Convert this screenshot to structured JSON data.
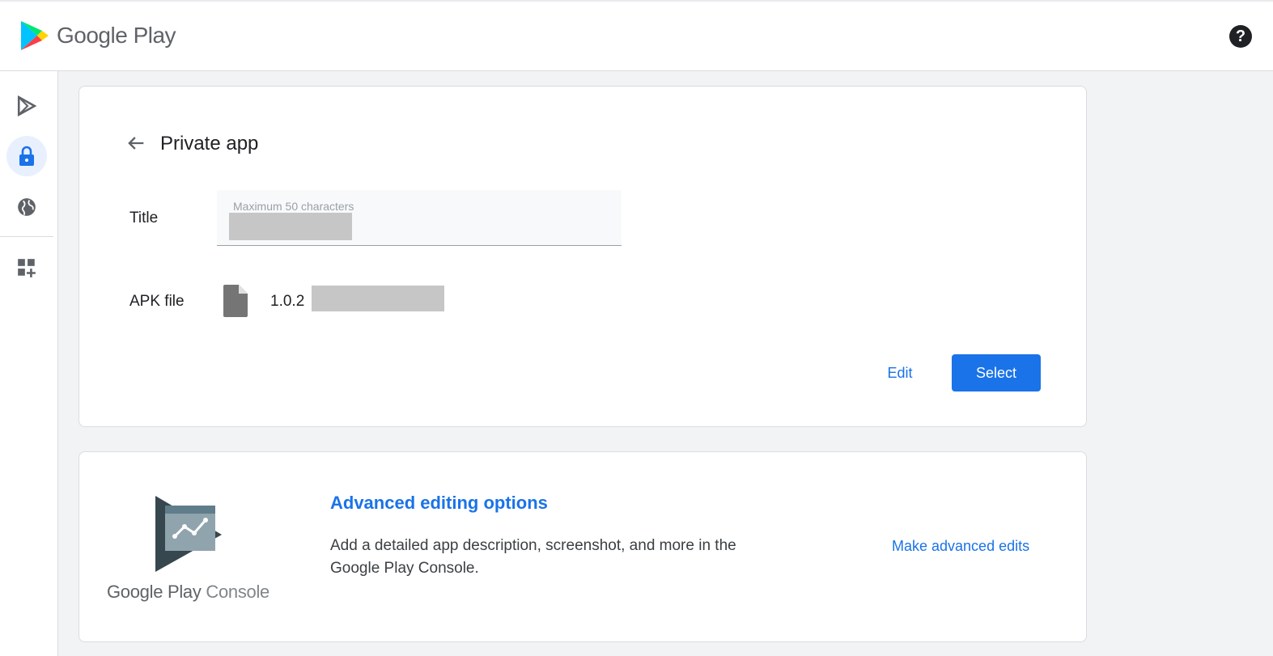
{
  "header": {
    "brand": "Google Play",
    "help_icon": "help-circle-icon",
    "help_glyph": "?"
  },
  "rail": {
    "items": [
      {
        "icon": "play-apps-icon",
        "active": false
      },
      {
        "icon": "lock-icon",
        "active": true
      },
      {
        "icon": "globe-icon",
        "active": false
      },
      {
        "icon": "widgets-add-icon",
        "active": false
      }
    ]
  },
  "private_app": {
    "title": "Private app",
    "title_label": "Title",
    "title_placeholder": "Maximum 50 characters",
    "apk_label": "APK file",
    "apk_version": "1.0.2",
    "edit_label": "Edit",
    "select_label": "Select"
  },
  "advanced": {
    "logo_text_a": "Google Play",
    "logo_text_b": "Console",
    "title": "Advanced editing options",
    "description": "Add a detailed app description, screenshot, and more in the Google Play Console.",
    "link": "Make advanced edits"
  },
  "colors": {
    "accent": "#1a73e8",
    "active_bg": "#e8f0fe",
    "icon_gray": "#5f6368"
  }
}
